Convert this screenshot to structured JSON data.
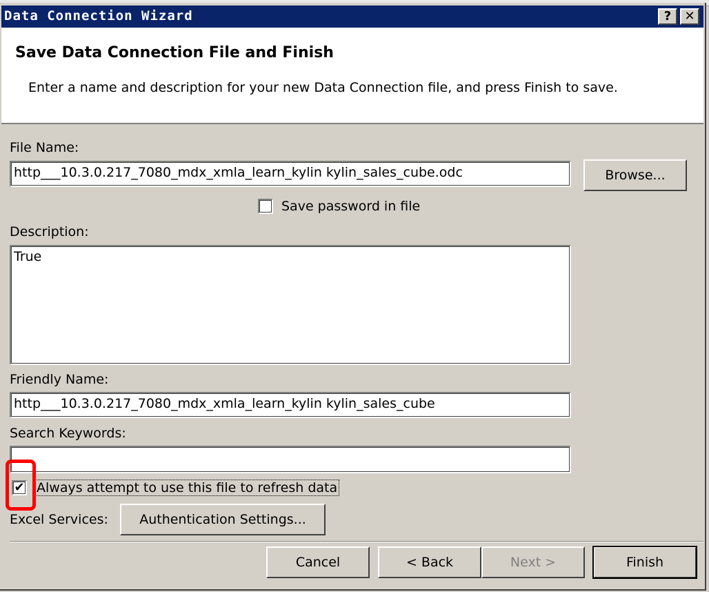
{
  "window": {
    "title": "Data Connection Wizard",
    "help_glyph": "?",
    "close_glyph": "✕"
  },
  "header": {
    "title": "Save Data Connection File and Finish",
    "description": "Enter a name and description for your new Data Connection file, and press Finish to save."
  },
  "file_name": {
    "label": "File Name:",
    "value": "http___10.3.0.217_7080_mdx_xmla_learn_kylin kylin_sales_cube.odc",
    "browse_label": "Browse..."
  },
  "save_password": {
    "label": "Save password in file",
    "checked": false
  },
  "description": {
    "label": "Description:",
    "value": "True"
  },
  "friendly_name": {
    "label": "Friendly Name:",
    "value": "http___10.3.0.217_7080_mdx_xmla_learn_kylin kylin_sales_cube"
  },
  "search_keywords": {
    "label": "Search Keywords:",
    "value": ""
  },
  "always_attempt": {
    "label": "Always attempt to use this file to refresh data",
    "checked": true,
    "check_glyph": "✔"
  },
  "excel_services": {
    "label": "Excel Services:",
    "auth_button_label": "Authentication Settings..."
  },
  "footer": {
    "cancel_label": "Cancel",
    "back_label": "< Back",
    "next_label": "Next >",
    "finish_label": "Finish"
  },
  "colors": {
    "titlebar": "#0a246a",
    "dialog_bg": "#d4d0c8",
    "highlight": "#ff0000"
  }
}
